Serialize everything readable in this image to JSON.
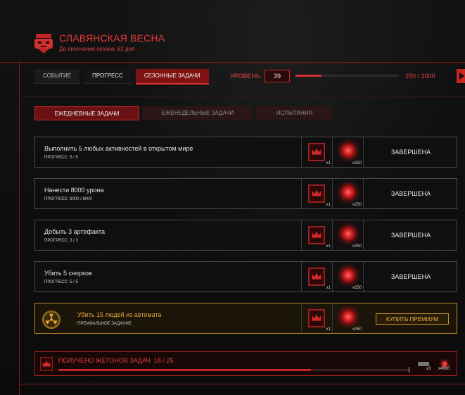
{
  "header": {
    "title": "СЛАВЯНСКАЯ ВЕСНА",
    "subtitle": "До окончания сезона: 62 дня"
  },
  "top_tabs": [
    {
      "label": "СОБЫТИЕ",
      "state": "normal"
    },
    {
      "label": "ПРОГРЕСС",
      "state": "selected"
    },
    {
      "label": "СЕЗОННЫЕ ЗАДАЧИ",
      "state": "active"
    }
  ],
  "level": {
    "label": "УРОВЕНЬ",
    "value": "39",
    "progress_text": "250 / 1000",
    "progress_fraction": 0.25
  },
  "sub_tabs": [
    {
      "label": "ЕЖЕДНЕВНЫЕ ЗАДАЧИ",
      "active": true
    },
    {
      "label": "ЕЖЕНЕДЕЛЬНЫЕ ЗАДАЧИ",
      "active": false
    },
    {
      "label": "ИСПЫТАНИЯ",
      "active": false
    }
  ],
  "tasks": [
    {
      "title": "Выполнить 5 любых активностей в открытом мире",
      "progress": "ПРОГРЕСС: 5 / 5",
      "reward1_qty": "x1",
      "reward2_qty": "x250",
      "status": "ЗАВЕРШЕНА"
    },
    {
      "title": "Нанести 8000 урона",
      "progress": "ПРОГРЕСС: 8000 / 8000",
      "reward1_qty": "x1",
      "reward2_qty": "x250",
      "status": "ЗАВЕРШЕНА"
    },
    {
      "title": "Добыть 3 артефакта",
      "progress": "ПРОГРЕСС: 3 / 3",
      "reward1_qty": "x1",
      "reward2_qty": "x250",
      "status": "ЗАВЕРШЕНА"
    },
    {
      "title": "Убить 5 снорков",
      "progress": "ПРОГРЕСС: 5 / 5",
      "reward1_qty": "x1",
      "reward2_qty": "x250",
      "status": "ЗАВЕРШЕНА"
    }
  ],
  "premium_task": {
    "title": "Убить 15 людей из автомата",
    "subtitle": "ПРЕМИАЛЬНОЕ ЗАДАНИЕ",
    "reward1_qty": "x1",
    "reward2_qty": "x250",
    "button": "КУПИТЬ ПРЕМИУМ"
  },
  "tokens": {
    "label": "ПОЛУЧЕНО ЖЕТОНОВ ЗАДАЧ",
    "count": "18 / 25",
    "progress_fraction": 0.72,
    "reward_a_qty": "x3",
    "reward_b_qty": "x4000"
  },
  "colors": {
    "accent": "#e03030",
    "premium": "#e0a33a",
    "background": "#0d0d0d"
  }
}
